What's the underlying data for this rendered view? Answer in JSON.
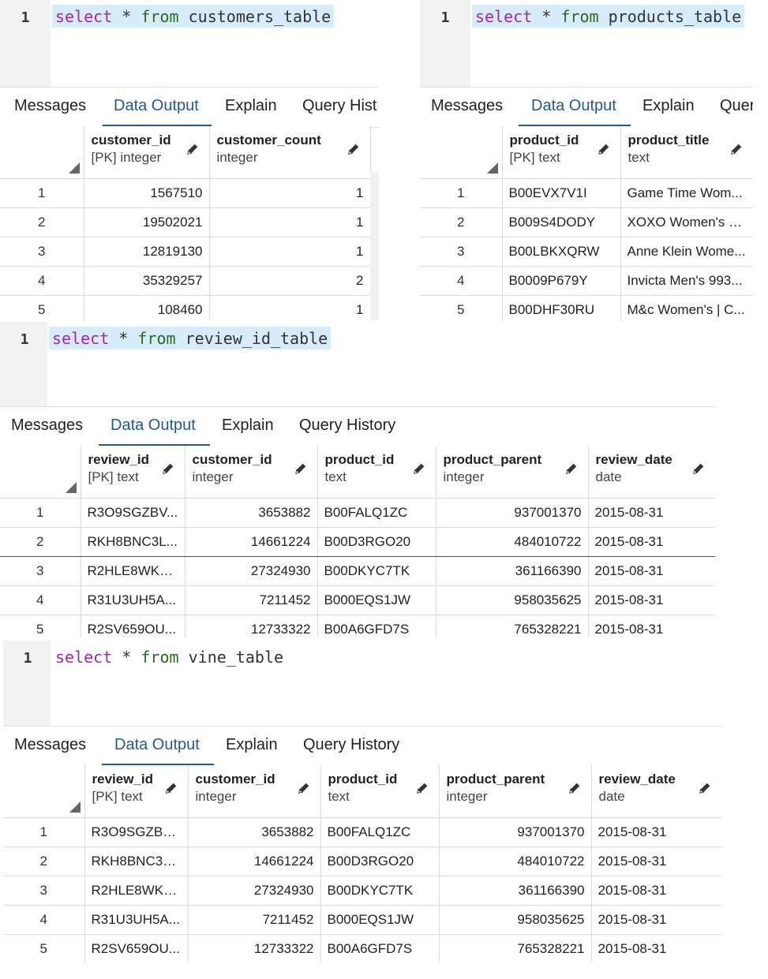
{
  "tabs": [
    "Messages",
    "Data Output",
    "Explain",
    "Query History"
  ],
  "tabs_truncated_1": [
    "Messages",
    "Data Output",
    "Explain",
    "Query Hist"
  ],
  "tabs_truncated_2": [
    "Messages",
    "Data Output",
    "Explain",
    "Quer"
  ],
  "line_number": "1",
  "kw_select": "select",
  "kw_star": "*",
  "kw_from": "from",
  "panels": [
    {
      "table_name": "customers_table",
      "columns": [
        {
          "name": "customer_id",
          "type": "[PK] integer"
        },
        {
          "name": "customer_count",
          "type": "integer"
        }
      ],
      "rows": [
        [
          "1",
          "1567510",
          "1"
        ],
        [
          "2",
          "19502021",
          "1"
        ],
        [
          "3",
          "12819130",
          "1"
        ],
        [
          "4",
          "35329257",
          "2"
        ],
        [
          "5",
          "108460",
          "1"
        ]
      ]
    },
    {
      "table_name": "products_table",
      "columns": [
        {
          "name": "product_id",
          "type": "[PK] text"
        },
        {
          "name": "product_title",
          "type": "text"
        }
      ],
      "rows": [
        [
          "1",
          "B00EVX7V1I",
          "Game Time Wom..."
        ],
        [
          "2",
          "B009S4DODY",
          "XOXO Women's X..."
        ],
        [
          "3",
          "B00LBKXQRW",
          "Anne Klein Wome..."
        ],
        [
          "4",
          "B0009P679Y",
          "Invicta Men's 993..."
        ],
        [
          "5",
          "B00DHF30RU",
          "M&c Women's | C..."
        ]
      ]
    },
    {
      "table_name": "review_id_table",
      "columns": [
        {
          "name": "review_id",
          "type": "[PK] text"
        },
        {
          "name": "customer_id",
          "type": "integer"
        },
        {
          "name": "product_id",
          "type": "text"
        },
        {
          "name": "product_parent",
          "type": "integer"
        },
        {
          "name": "review_date",
          "type": "date"
        }
      ],
      "rows": [
        [
          "1",
          "R3O9SGZBV...",
          "3653882",
          "B00FALQ1ZC",
          "937001370",
          "2015-08-31"
        ],
        [
          "2",
          "RKH8BNC3L...",
          "14661224",
          "B00D3RGO20",
          "484010722",
          "2015-08-31"
        ],
        [
          "3",
          "R2HLE8WKZ...",
          "27324930",
          "B00DKYC7TK",
          "361166390",
          "2015-08-31"
        ],
        [
          "4",
          "R31U3UH5A...",
          "7211452",
          "B000EQS1JW",
          "958035625",
          "2015-08-31"
        ],
        [
          "5",
          "R2SV659OU...",
          "12733322",
          "B00A6GFD7S",
          "765328221",
          "2015-08-31"
        ]
      ]
    },
    {
      "table_name": "vine_table",
      "columns": [
        {
          "name": "review_id",
          "type": "[PK] text"
        },
        {
          "name": "customer_id",
          "type": "integer"
        },
        {
          "name": "product_id",
          "type": "text"
        },
        {
          "name": "product_parent",
          "type": "integer"
        },
        {
          "name": "review_date",
          "type": "date"
        }
      ],
      "rows": [
        [
          "1",
          "R3O9SGZBV...",
          "3653882",
          "B00FALQ1ZC",
          "937001370",
          "2015-08-31"
        ],
        [
          "2",
          "RKH8BNC3L...",
          "14661224",
          "B00D3RGO20",
          "484010722",
          "2015-08-31"
        ],
        [
          "3",
          "R2HLE8WKZ...",
          "27324930",
          "B00DKYC7TK",
          "361166390",
          "2015-08-31"
        ],
        [
          "4",
          "R31U3UH5A...",
          "7211452",
          "B000EQS1JW",
          "958035625",
          "2015-08-31"
        ],
        [
          "5",
          "R2SV659OU...",
          "12733322",
          "B00A6GFD7S",
          "765328221",
          "2015-08-31"
        ]
      ]
    }
  ]
}
